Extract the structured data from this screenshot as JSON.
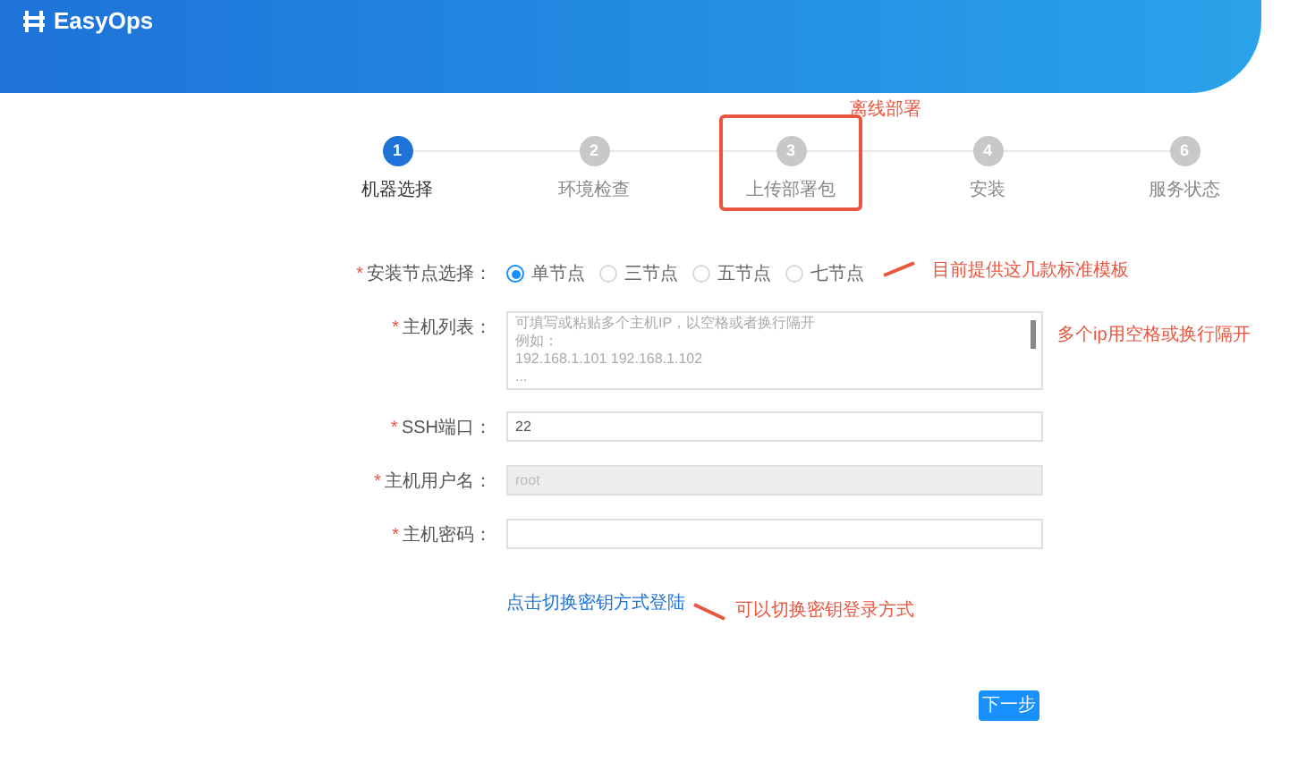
{
  "header": {
    "logo": "EasyOps"
  },
  "steps": [
    {
      "number": "1",
      "label": "机器选择",
      "selected": true,
      "boxed": false
    },
    {
      "number": "2",
      "label": "环境检查",
      "selected": false,
      "boxed": false
    },
    {
      "number": "3",
      "label": "上传部署包",
      "selected": false,
      "boxed": true,
      "note": "离线部署"
    },
    {
      "number": "4",
      "label": "安装",
      "selected": false,
      "boxed": false
    },
    {
      "number": "6",
      "label": "服务状态",
      "selected": false,
      "boxed": false
    }
  ],
  "form": [
    {
      "kind": "radio",
      "label": "安装节点选择：",
      "required_mark": "*",
      "options": [
        {
          "label": "单节点",
          "selected": true
        },
        {
          "label": "三节点",
          "selected": false
        },
        {
          "label": "五节点",
          "selected": false
        },
        {
          "label": "七节点",
          "selected": false
        }
      ],
      "note": "目前提供这几款标准模板"
    },
    {
      "kind": "textarea",
      "label": "主机列表：",
      "required_mark": "*",
      "placeholder": [
        "可填写或粘贴多个主机IP，以空格或者换行隔开",
        "例如：",
        "192.168.1.101 192.168.1.102",
        "..."
      ],
      "note": "多个ip用空格或换行隔开"
    },
    {
      "kind": "input",
      "label": "SSH端口：",
      "required_mark": "*",
      "value": "22",
      "disabled": false
    },
    {
      "kind": "input",
      "label": "主机用户名：",
      "required_mark": "*",
      "value": "root",
      "disabled": true
    },
    {
      "kind": "input",
      "label": "主机密码：",
      "required_mark": "*",
      "disabled": false
    }
  ],
  "switch_link": {
    "label": "点击切换密钥方式登陆",
    "note": "可以切换密钥登录方式"
  },
  "next_button": "下一步"
}
